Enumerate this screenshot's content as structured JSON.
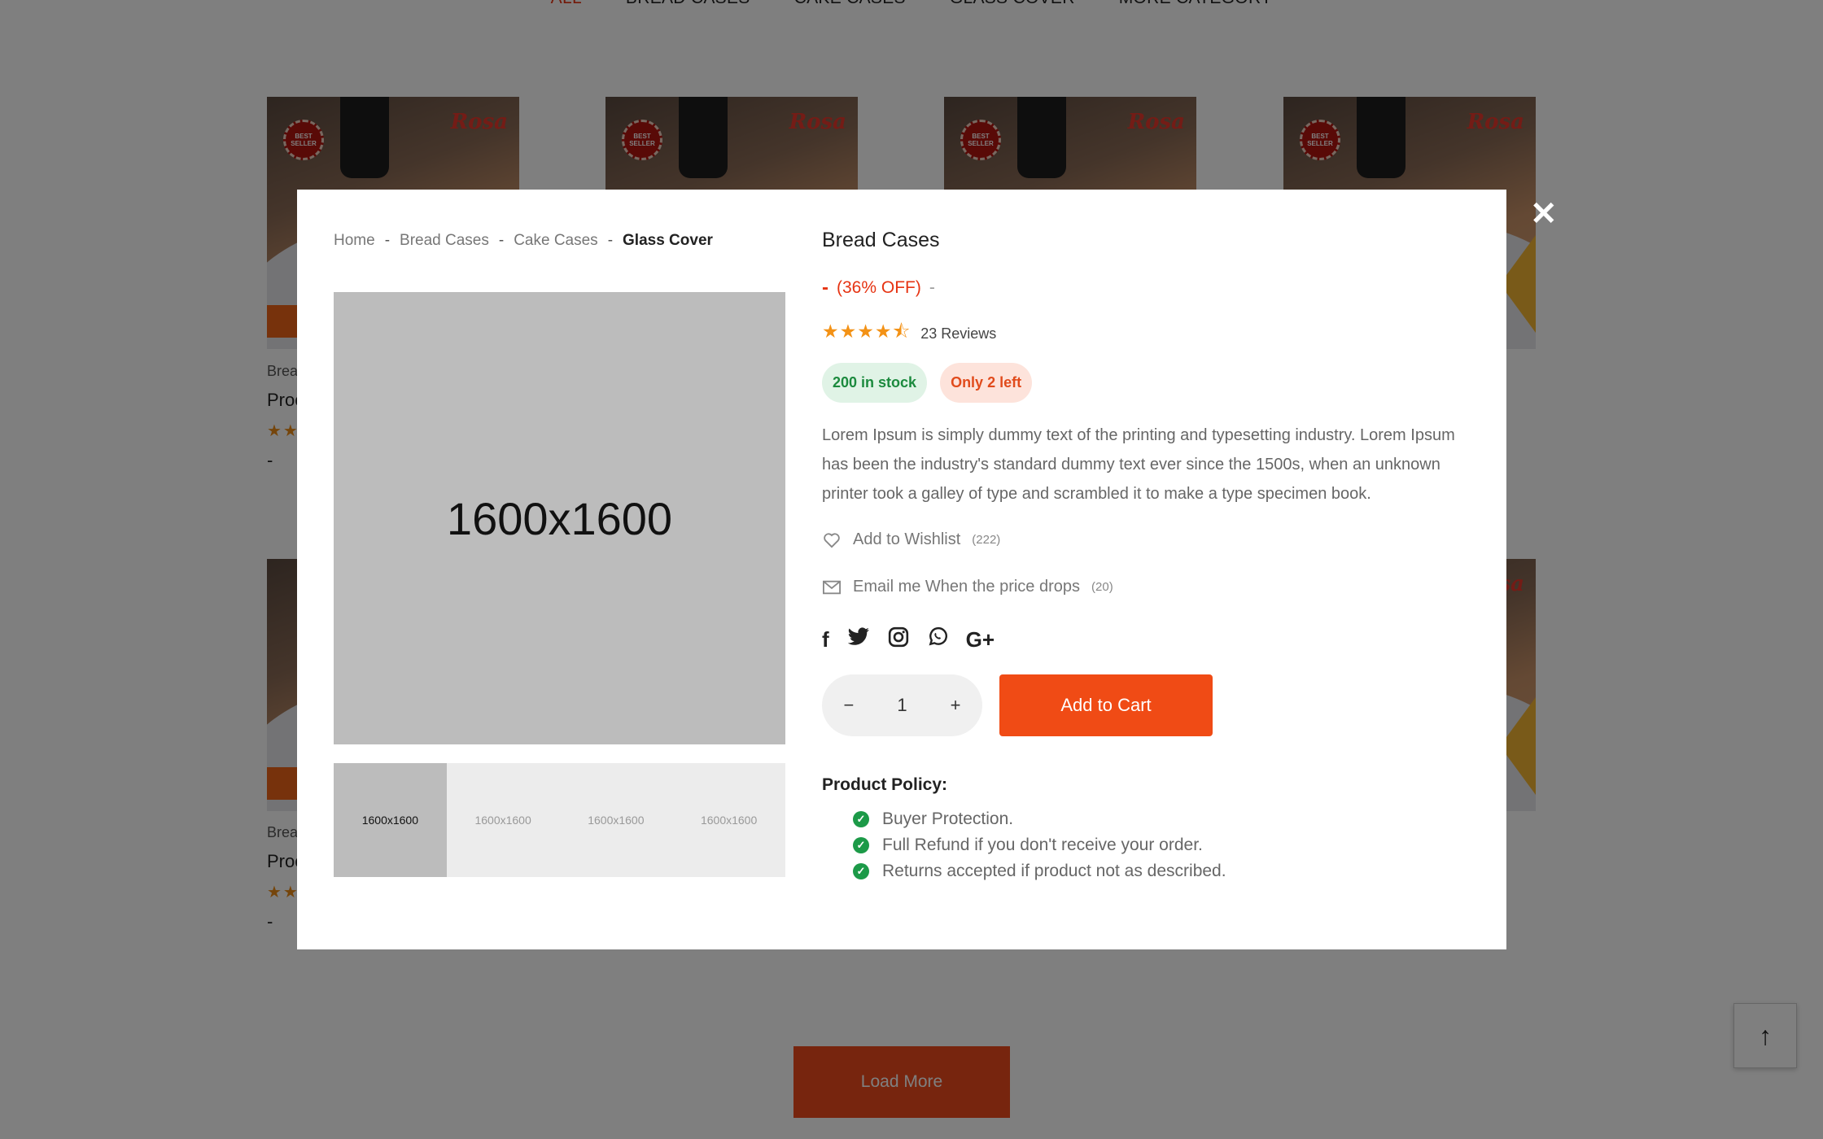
{
  "nav": {
    "items": [
      "ALL",
      "BREAD CASES",
      "CAKE CASES",
      "GLASS COVER",
      "MORE CATEGORY"
    ]
  },
  "card": {
    "badge": "BEST SELLER",
    "brand": "Rosa",
    "category_partial": "Brea",
    "name_partial": "Proc",
    "price": "-"
  },
  "page": {
    "load_more": "Load More",
    "to_top_icon": "arrow-up-icon"
  },
  "modal": {
    "close_icon": "close-icon",
    "breadcrumb": [
      "Home",
      "Bread Cases",
      "Cake Cases",
      "Glass Cover"
    ],
    "breadcrumb_sep": "-",
    "image_label": "1600x1600",
    "thumbnails": [
      "1600x1600",
      "1600x1600",
      "1600x1600",
      "1600x1600"
    ],
    "title": "Bread Cases",
    "price_minus": "-",
    "discount": "(36% OFF)",
    "price_dash": "-",
    "rating": 4.5,
    "reviews": "23 Reviews",
    "stock": "200 in stock",
    "left": "Only 2 left",
    "description": "Lorem Ipsum is simply dummy text of the printing and typesetting industry. Lorem Ipsum has been the industry's standard dummy text ever since the 1500s, when an unknown printer took a galley of type and scrambled it to make a type specimen book.",
    "wishlist": {
      "label": "Add to Wishlist",
      "count": "(222)"
    },
    "email": {
      "label": "Email me When the price drops",
      "count": "(20)"
    },
    "social": [
      "facebook-icon",
      "twitter-icon",
      "instagram-icon",
      "whatsapp-icon",
      "google-plus-icon"
    ],
    "qty": "1",
    "add_to_cart": "Add to Cart",
    "policy_heading": "Product Policy:",
    "policy": [
      "Buyer Protection.",
      "Full Refund if you don't receive your order.",
      "Returns accepted if product not as described."
    ],
    "colors": {
      "accent": "#f04b15",
      "stock_green": "#1c8a3e",
      "star": "#f39216"
    }
  }
}
